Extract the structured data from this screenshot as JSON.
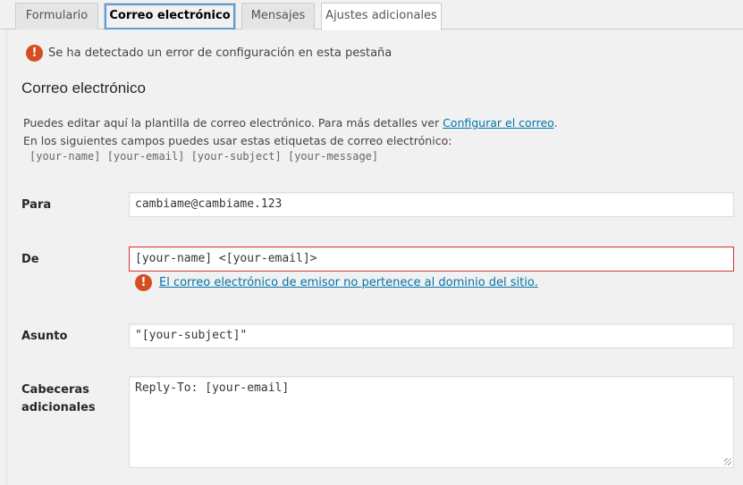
{
  "tabs": [
    {
      "label": "Formulario"
    },
    {
      "label": "Correo electrónico"
    },
    {
      "label": "Mensajes"
    },
    {
      "label": "Ajustes adicionales"
    }
  ],
  "config_error": {
    "icon": "!",
    "text": "Se ha detectado un error de configuración en esta pestaña"
  },
  "section": {
    "title": "Correo electrónico",
    "desc_line1_prefix": "Puedes editar aquí la plantilla de correo electrónico. Para más detalles ver ",
    "desc_link": "Configurar el correo",
    "desc_line1_suffix": ".",
    "desc_line2": "En los siguientes campos puedes usar estas etiquetas de correo electrónico:",
    "tags": "[your-name] [your-email] [your-subject] [your-message]"
  },
  "fields": {
    "to": {
      "label": "Para",
      "value": "cambiame@cambiame.123"
    },
    "from": {
      "label": "De",
      "value": "[your-name] <[your-email]>",
      "error": "El correo electrónico de emisor no pertenece al dominio del sitio."
    },
    "subject": {
      "label": "Asunto",
      "value": "\"[your-subject]\""
    },
    "headers": {
      "label_line1": "Cabeceras",
      "label_line2": "adicionales",
      "value": "Reply-To: [your-email]"
    }
  },
  "colors": {
    "error": "#d54e21",
    "link": "#0073aa",
    "focus": "#5b9dd9"
  }
}
